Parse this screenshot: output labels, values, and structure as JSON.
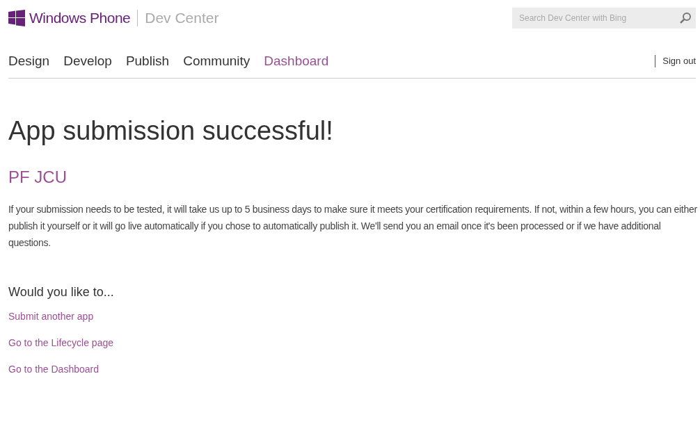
{
  "header": {
    "brand": "Windows Phone",
    "section": "Dev Center",
    "search": {
      "placeholder": "Search Dev Center with Bing"
    }
  },
  "nav": [
    {
      "label": "Design",
      "selected": false
    },
    {
      "label": "Develop",
      "selected": false
    },
    {
      "label": "Publish",
      "selected": false
    },
    {
      "label": "Community",
      "selected": false
    },
    {
      "label": "Dashboard",
      "selected": true
    }
  ],
  "sign_out": "Sign out",
  "title": "App submission successful!",
  "app_name": "PF JCU",
  "message": "If your submission needs to be tested, it will take us up to 5 business days to make sure it meets your certification requirements. If not, within a few hours, you can either publish it yourself or it will go live automatically if you chose to automatically publish it. We'll send you an email once it's been processed or if we have additional questions.",
  "next_heading": "Would you like to...",
  "links": [
    "Submit another app",
    "Go to the Lifecycle page",
    "Go to the Dashboard"
  ]
}
